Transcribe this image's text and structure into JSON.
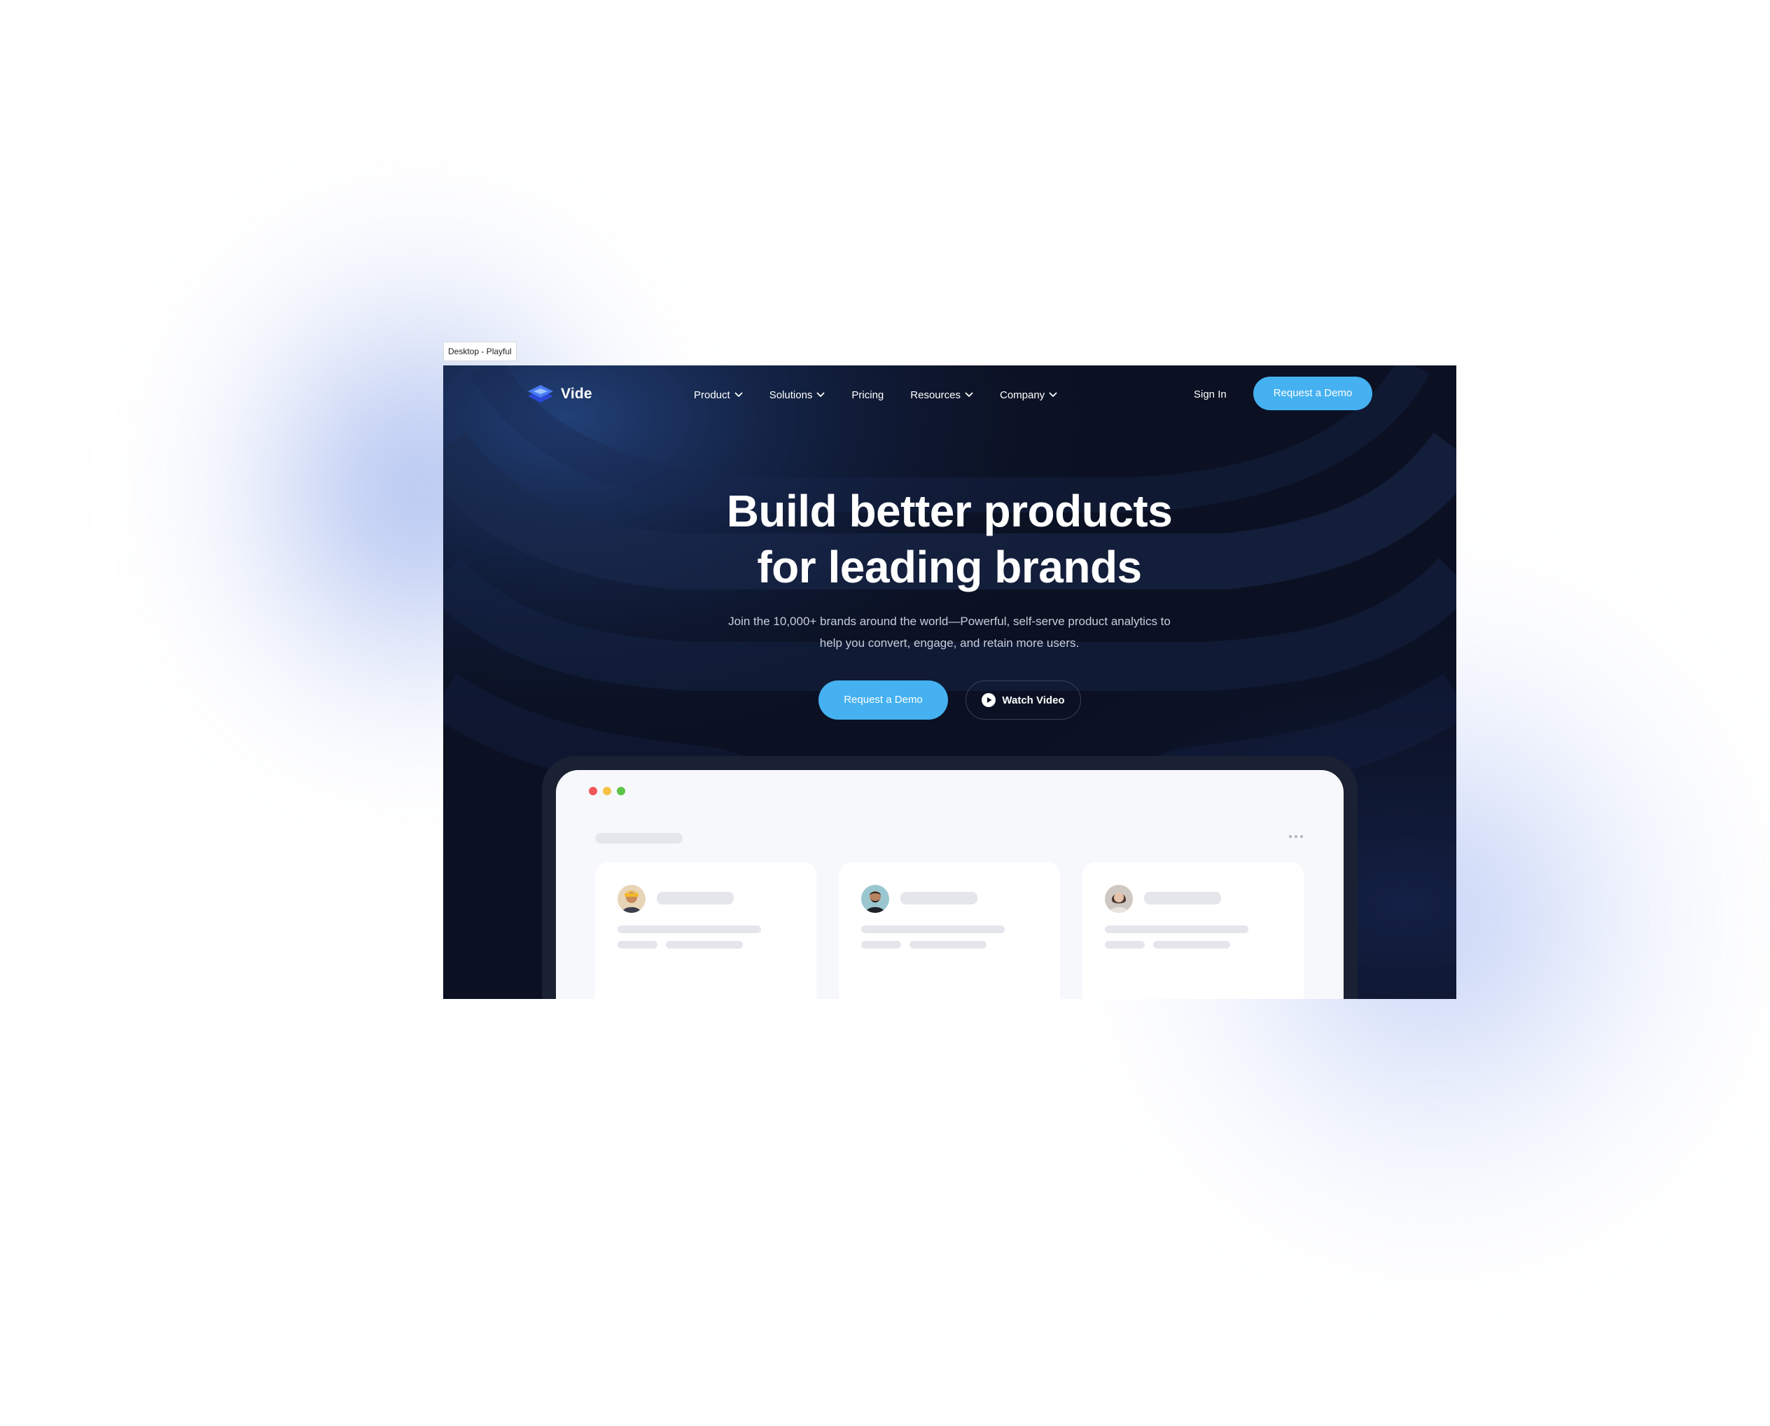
{
  "frame": {
    "label": "Desktop - Playful"
  },
  "nav": {
    "brand": "Vide",
    "menu": [
      {
        "label": "Product",
        "has_dropdown": true
      },
      {
        "label": "Solutions",
        "has_dropdown": true
      },
      {
        "label": "Pricing",
        "has_dropdown": false
      },
      {
        "label": "Resources",
        "has_dropdown": true
      },
      {
        "label": "Company",
        "has_dropdown": true
      }
    ],
    "sign_in": "Sign In",
    "cta": "Request a Demo"
  },
  "hero": {
    "title_line1": "Build better products",
    "title_line2": "for leading brands",
    "subtitle_line1": "Join the 10,000+ brands around the world—Powerful, self-serve product analytics to",
    "subtitle_line2": "help you convert, engage, and retain more users.",
    "primary_cta": "Request a Demo",
    "secondary_cta": "Watch Video"
  },
  "colors": {
    "background_dark": "#0b1123",
    "accent": "#45b1f0",
    "window_red": "#f0575a",
    "window_yellow": "#f6c244",
    "window_green": "#5cc447"
  },
  "icons": {
    "logo": "layers-logo-icon",
    "dropdown": "chevron-down-icon",
    "play": "play-circle-icon",
    "more": "more-horizontal-icon"
  }
}
